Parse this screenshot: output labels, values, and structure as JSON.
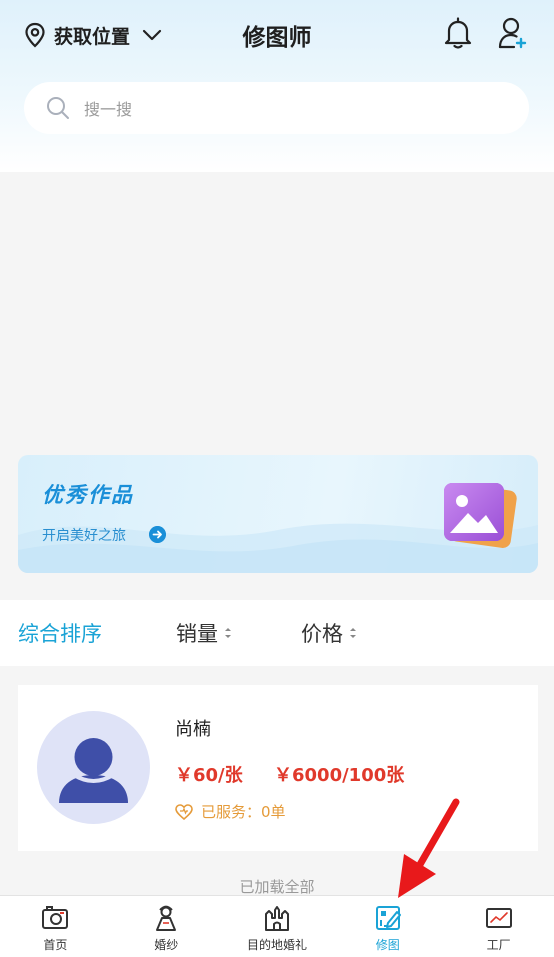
{
  "header": {
    "location_label": "获取位置",
    "title": "修图师"
  },
  "search": {
    "placeholder": "搜一搜"
  },
  "promo": {
    "title": "优秀作品",
    "subtitle": "开启美好之旅"
  },
  "sort": {
    "items": [
      {
        "label": "综合排序",
        "active": true
      },
      {
        "label": "销量",
        "active": false
      },
      {
        "label": "价格",
        "active": false
      }
    ]
  },
  "card": {
    "name": "尚楠",
    "price_single": "￥60/张",
    "price_bulk": "￥6000/100张",
    "served": "已服务：0单"
  },
  "list_footer": "已加载全部",
  "tabbar": {
    "items": [
      {
        "label": "首页",
        "icon": "camera-icon"
      },
      {
        "label": "婚纱",
        "icon": "bride-icon"
      },
      {
        "label": "目的地婚礼",
        "icon": "castle-icon"
      },
      {
        "label": "修图",
        "icon": "edit-photo-icon",
        "active": true
      },
      {
        "label": "工厂",
        "icon": "chart-icon"
      }
    ]
  },
  "colors": {
    "accent": "#1aa3d6",
    "price": "#e0392b",
    "served": "#e59b3a"
  }
}
